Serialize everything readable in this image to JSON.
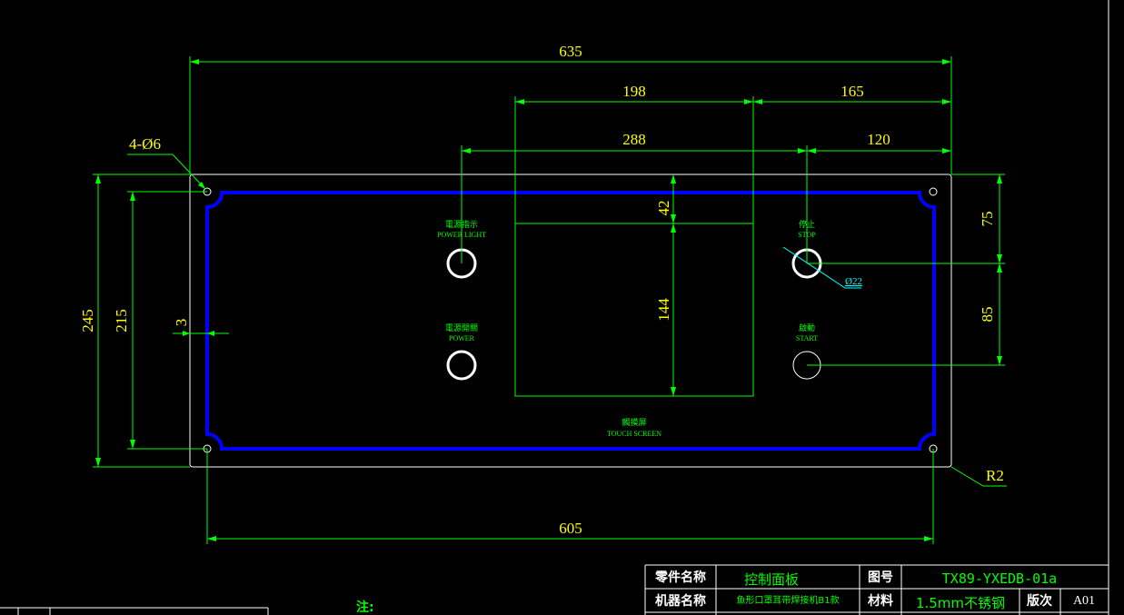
{
  "colors": {
    "background": "#000000",
    "dimension_line": "#00ff00",
    "dimension_text": "#ffff00",
    "outline": "#ffffff",
    "inner_border": "#0000ff",
    "leader_cyan": "#00ffff"
  },
  "dimensions": {
    "total_width": "635",
    "d198": "198",
    "d165": "165",
    "d288": "288",
    "d120": "120",
    "d42": "42",
    "d144": "144",
    "d75": "75",
    "d85": "85",
    "total_height": "245",
    "inner_height": "215",
    "margin": "3",
    "bottom_width": "605"
  },
  "callouts": {
    "holes": "4-Ø6",
    "corner_radius": "R2",
    "button_diameter": "Ø22"
  },
  "labels": {
    "power_light_cn": "電源指示",
    "power_light_en": "POWER LIGHT",
    "power_cn": "電源開關",
    "power_en": "POWER",
    "stop_cn": "停止",
    "stop_en": "STOP",
    "start_cn": "啟動",
    "start_en": "START",
    "touch_cn": "觸摸屏",
    "touch_en": "TOUCH SCREEN"
  },
  "title_block": {
    "part_name_label": "零件名称",
    "part_name_value": "控制面板",
    "drawing_no_label": "图号",
    "drawing_no_value": "TX89-YXEDB-01a",
    "machine_name_label": "机器名称",
    "machine_name_value": "鱼形口罩耳带焊接机B1款",
    "material_label": "材料",
    "material_value": "1.5mm不锈钢",
    "revision_label": "版次",
    "revision_value": "A01",
    "note_label": "注:"
  }
}
